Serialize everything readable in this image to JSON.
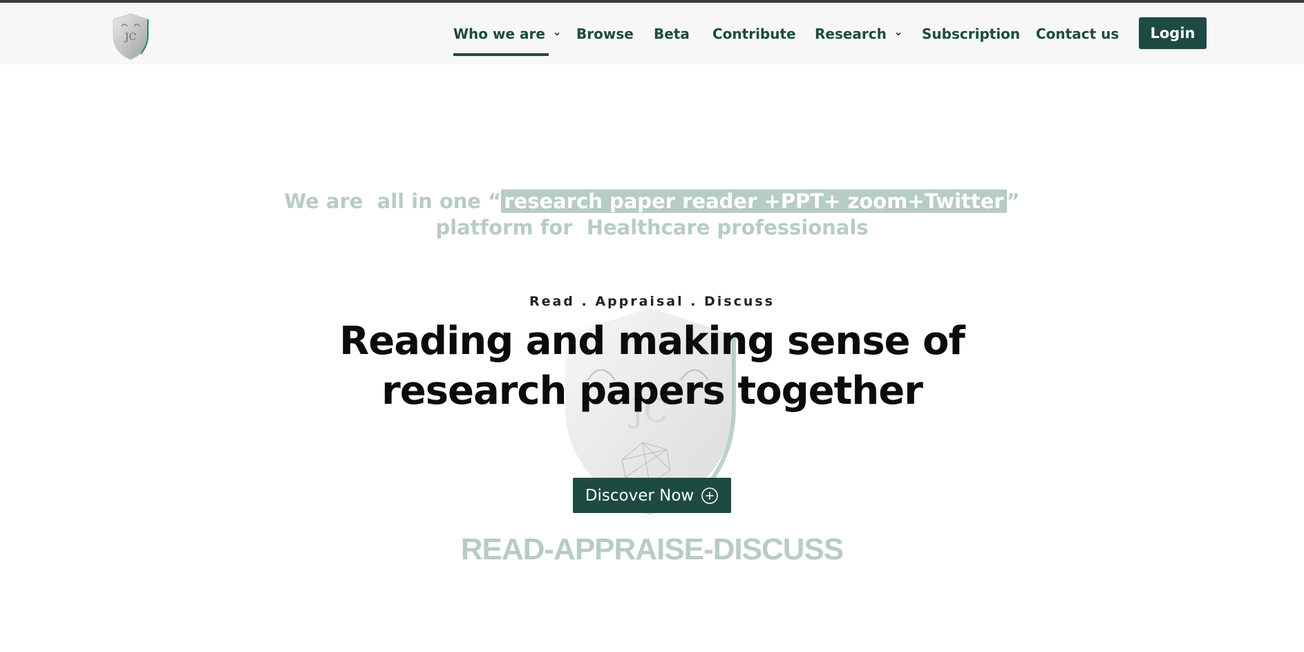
{
  "nav": {
    "items": [
      {
        "label": "Who we are",
        "has_dropdown": true,
        "active": true
      },
      {
        "label": "Browse",
        "has_dropdown": false
      },
      {
        "label": "Beta",
        "has_dropdown": false
      },
      {
        "label": "Contribute",
        "has_dropdown": false
      },
      {
        "label": "Research",
        "has_dropdown": true
      },
      {
        "label": "Subscription",
        "has_dropdown": false
      },
      {
        "label": "Contact us",
        "has_dropdown": false
      }
    ],
    "login_label": "Login"
  },
  "logo": {
    "text": "JC",
    "icon": "shield-logo-icon"
  },
  "hero": {
    "tagline_pre": "We are  all in one “",
    "tagline_highlight": "research paper reader +PPT+ zoom+Twitter",
    "tagline_post": "”",
    "tagline_line2": "platform for  Healthcare professionals",
    "kicker": "Read . Appraisal . Discuss",
    "headline_line1": "Reading and making sense of",
    "headline_line2": "research papers together",
    "cta_label": "Discover Now",
    "cta_icon": "plus-circle-icon",
    "rad_text": "READ-APPRAISE-DISCUSS"
  },
  "colors": {
    "brand": "#1d4a42",
    "muted": "#b7ccc4",
    "header_bg": "#f7f7f7"
  }
}
